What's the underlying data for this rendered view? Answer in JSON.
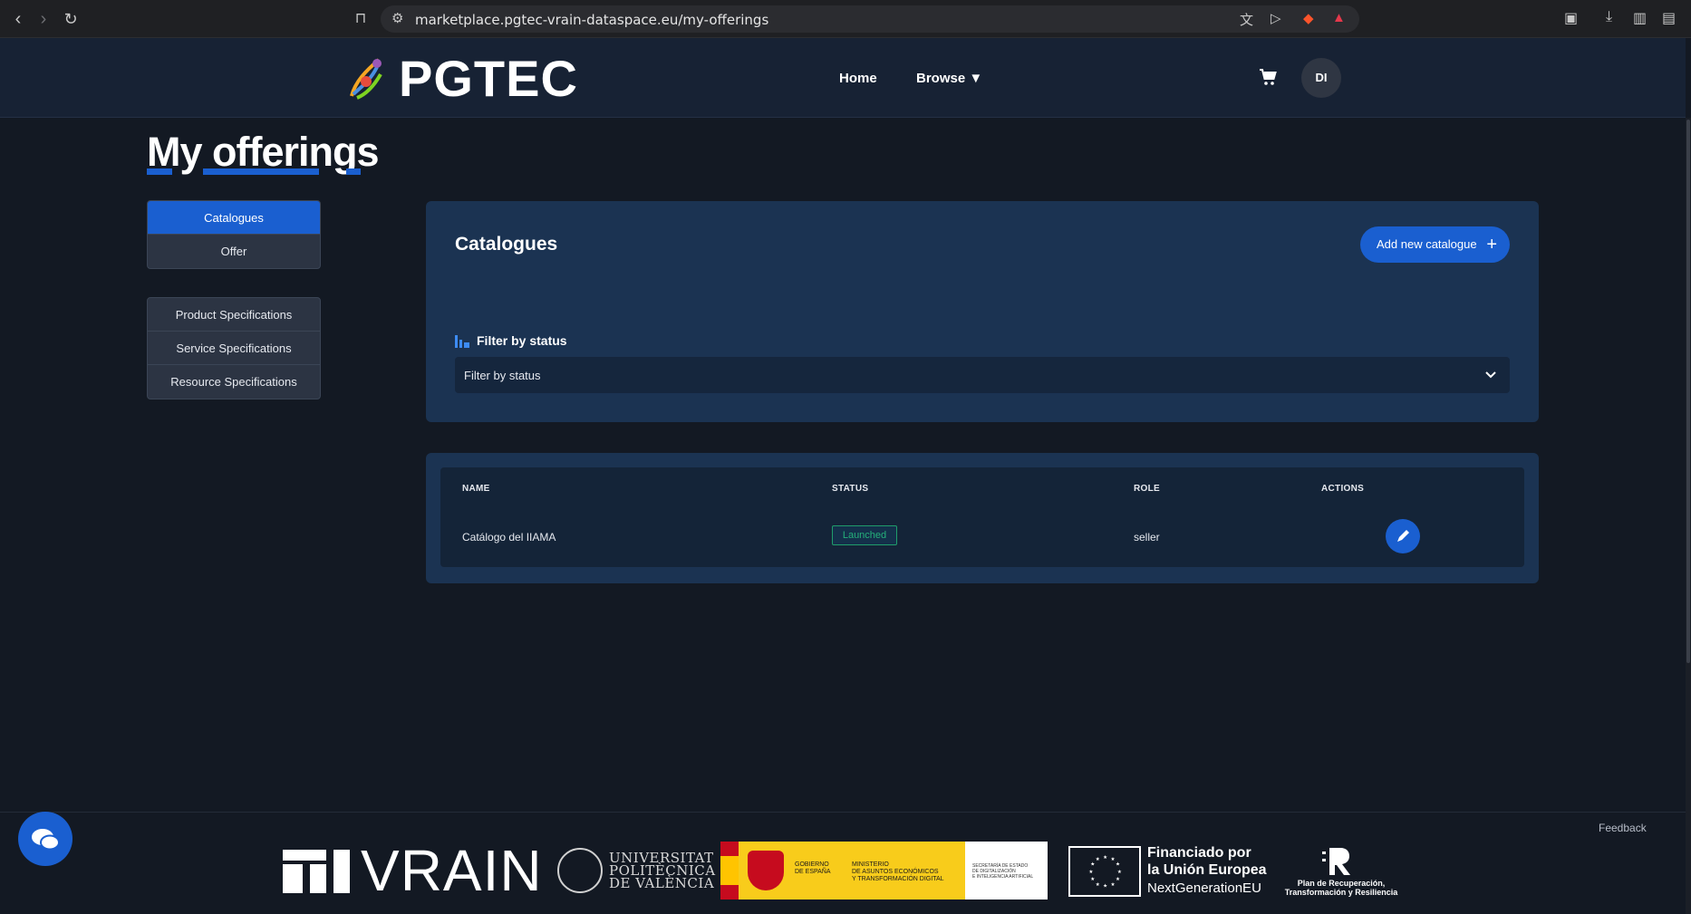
{
  "browser": {
    "url": "marketplace.pgtec-vrain-dataspace.eu/my-offerings"
  },
  "header": {
    "logo_text": "PGTEC",
    "nav": {
      "home": "Home",
      "browse": "Browse ▼"
    },
    "avatar_initials": "DI"
  },
  "page": {
    "title_part1": "My",
    "title_part2": "offerings"
  },
  "sidebar": {
    "group1": [
      {
        "label": "Catalogues",
        "active": true
      },
      {
        "label": "Offer",
        "active": false
      }
    ],
    "group2": [
      {
        "label": "Product Specifications"
      },
      {
        "label": "Service Specifications"
      },
      {
        "label": "Resource Specifications"
      }
    ]
  },
  "catalogues_card": {
    "title": "Catalogues",
    "add_button": "Add new catalogue",
    "filter_label": "Filter by status",
    "filter_value": "Filter by status"
  },
  "table": {
    "columns": [
      "NAME",
      "STATUS",
      "ROLE",
      "ACTIONS"
    ],
    "rows": [
      {
        "name": "Catálogo del IIAMA",
        "status": "Launched",
        "role": "seller"
      }
    ]
  },
  "footer": {
    "feedback": "Feedback",
    "vrain": "VRAIN",
    "upv_line1": "UNIVERSITAT",
    "upv_line2": "POLITÈCNICA",
    "upv_line3": "DE VALÈNCIA",
    "gov1_line1": "GOBIERNO",
    "gov1_line2": "DE ESPAÑA",
    "gov2_line1": "MINISTERIO",
    "gov2_line2": "DE ASUNTOS ECONÓMICOS",
    "gov2_line3": "Y TRANSFORMACIÓN DIGITAL",
    "gov3_line1": "SECRETARÍA DE ESTADO",
    "gov3_line2": "DE DIGITALIZACIÓN",
    "gov3_line3": "E INTELIGENCIA ARTIFICIAL",
    "eu_line1": "Financiado por",
    "eu_line2": "la Unión Europea",
    "eu_sub": "NextGenerationEU",
    "prtr_line1": "Plan de Recuperación,",
    "prtr_line2": "Transformación y Resiliencia"
  },
  "colors": {
    "accent": "#1a5fd0",
    "background": "#131923",
    "card": "#1b3352",
    "status_launched": "#25b07a"
  }
}
